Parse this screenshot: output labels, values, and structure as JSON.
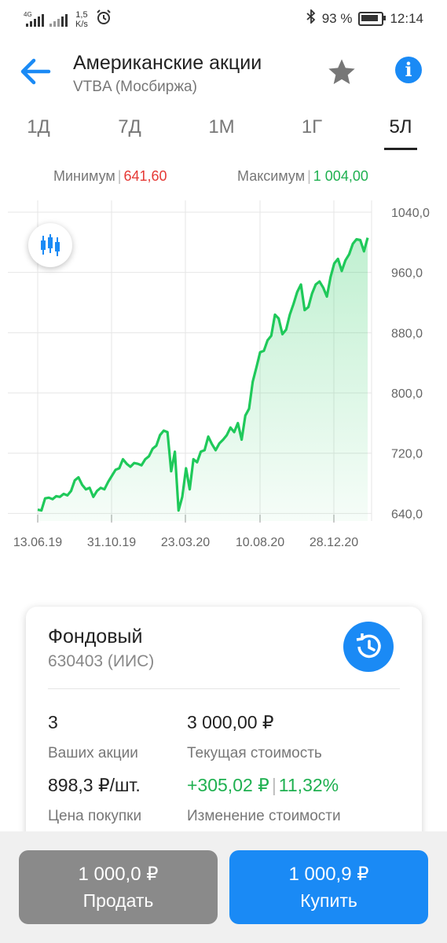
{
  "status_bar": {
    "network_tag_1": "4G",
    "speed": "1,5\nK/s",
    "speed_value": "1,5",
    "speed_unit": "K/s",
    "battery_percent": "93 %",
    "time": "12:14"
  },
  "header": {
    "title": "Американские акции",
    "subtitle": "VTBA (Мосбиржа)"
  },
  "periods": [
    "1Д",
    "7Д",
    "1М",
    "1Г",
    "5Л"
  ],
  "active_period": "5Л",
  "range": {
    "min_label": "Минимум",
    "min_value": "641,60",
    "max_label": "Максимум",
    "max_value": "1 004,00"
  },
  "chart_data": {
    "type": "area",
    "y_ticks": [
      "1040,0",
      "960,0",
      "880,0",
      "800,0",
      "720,0",
      "640,0"
    ],
    "x_ticks": [
      "13.06.19",
      "31.10.19",
      "23.03.20",
      "10.08.20",
      "28.12.20"
    ],
    "ylim": [
      630,
      1040
    ],
    "series_color": "#1fc95a",
    "values": [
      645,
      644,
      660,
      661,
      659,
      663,
      662,
      666,
      664,
      670,
      684,
      688,
      678,
      672,
      674,
      662,
      670,
      674,
      672,
      682,
      690,
      698,
      700,
      712,
      706,
      702,
      707,
      706,
      704,
      712,
      716,
      726,
      730,
      744,
      750,
      748,
      696,
      722,
      644,
      662,
      700,
      672,
      712,
      708,
      722,
      724,
      742,
      732,
      724,
      733,
      738,
      744,
      754,
      748,
      760,
      738,
      770,
      779,
      815,
      834,
      854,
      856,
      870,
      876,
      904,
      899,
      878,
      884,
      904,
      918,
      934,
      944,
      910,
      914,
      932,
      944,
      948,
      940,
      928,
      954,
      972,
      978,
      962,
      976,
      984,
      998,
      1004,
      1003,
      988,
      1006
    ]
  },
  "card": {
    "account_name": "Фондовый",
    "account_number": "630403 (ИИС)",
    "shares_value": "3",
    "shares_label": "Ваших акции",
    "current_cost_value": "3 000,00 ₽",
    "current_cost_label": "Текущая стоимость",
    "buy_price_value": "898,3 ₽/шт.",
    "buy_price_label": "Цена покупки",
    "change_value": "+305,02 ₽",
    "change_percent": "11,32%",
    "change_label": "Изменение стоимости"
  },
  "actions": {
    "sell_price": "1 000,0 ₽",
    "sell_label": "Продать",
    "buy_price": "1 000,9 ₽",
    "buy_label": "Купить"
  },
  "colors": {
    "accent": "#1a8af5",
    "positive": "#1fb050",
    "negative": "#e53935"
  }
}
